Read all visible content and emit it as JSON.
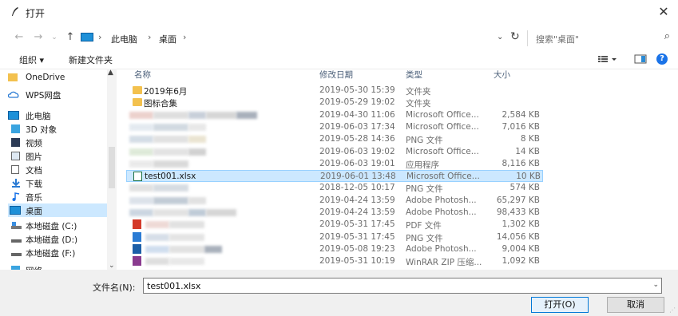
{
  "window": {
    "title": "打开",
    "close_glyph": "✕"
  },
  "address": {
    "breadcrumbs": [
      "此电脑",
      "桌面"
    ],
    "separator": "›",
    "search_placeholder": "搜索\"桌面\""
  },
  "toolbar": {
    "organize": "组织 ▾",
    "new_folder": "新建文件夹"
  },
  "sidebar": {
    "items": [
      {
        "label": "OneDrive",
        "icon": "folder-icon"
      },
      {
        "label": "WPS网盘",
        "icon": "cloud-icon"
      },
      {
        "label": "此电脑",
        "icon": "computer-icon"
      },
      {
        "label": "3D 对象",
        "icon": "cube-icon"
      },
      {
        "label": "视频",
        "icon": "video-icon"
      },
      {
        "label": "图片",
        "icon": "picture-icon"
      },
      {
        "label": "文档",
        "icon": "document-icon"
      },
      {
        "label": "下载",
        "icon": "download-icon"
      },
      {
        "label": "音乐",
        "icon": "music-icon"
      },
      {
        "label": "桌面",
        "icon": "desktop-icon",
        "selected": true
      },
      {
        "label": "本地磁盘 (C:)",
        "icon": "drive-c-icon"
      },
      {
        "label": "本地磁盘 (D:)",
        "icon": "drive-icon"
      },
      {
        "label": "本地磁盘 (F:)",
        "icon": "drive-icon"
      },
      {
        "label": "网络",
        "icon": "network-icon"
      }
    ]
  },
  "columns": {
    "name": "名称",
    "date": "修改日期",
    "type": "类型",
    "size": "大小"
  },
  "files": [
    {
      "name": "2019年6月",
      "date": "2019-05-30 15:39",
      "type": "文件夹",
      "size": "",
      "kind": "folder"
    },
    {
      "name": "图标合集",
      "date": "2019-05-29 19:02",
      "type": "文件夹",
      "size": "",
      "kind": "folder"
    },
    {
      "name": "",
      "date": "2019-04-30 11:06",
      "type": "Microsoft Office...",
      "size": "2,584 KB",
      "kind": "blur"
    },
    {
      "name": "",
      "date": "2019-06-03 17:34",
      "type": "Microsoft Office...",
      "size": "7,016 KB",
      "kind": "blur"
    },
    {
      "name": "",
      "date": "2019-05-28 14:36",
      "type": "PNG 文件",
      "size": "8 KB",
      "kind": "blur"
    },
    {
      "name": "",
      "date": "2019-06-03 19:02",
      "type": "Microsoft Office...",
      "size": "14 KB",
      "kind": "blur"
    },
    {
      "name": "",
      "date": "2019-06-03 19:01",
      "type": "应用程序",
      "size": "8,116 KB",
      "kind": "blur"
    },
    {
      "name": "test001.xlsx",
      "date": "2019-06-01 13:48",
      "type": "Microsoft Office...",
      "size": "10 KB",
      "kind": "excel",
      "selected": true
    },
    {
      "name": "",
      "date": "2018-12-05 10:17",
      "type": "PNG 文件",
      "size": "574 KB",
      "kind": "blur"
    },
    {
      "name": "",
      "date": "2019-04-24 13:59",
      "type": "Adobe Photosh...",
      "size": "65,297 KB",
      "kind": "blur"
    },
    {
      "name": "",
      "date": "2019-04-24 13:59",
      "type": "Adobe Photosh...",
      "size": "98,433 KB",
      "kind": "blur"
    },
    {
      "name": "",
      "date": "2019-05-31 17:45",
      "type": "PDF 文件",
      "size": "1,302 KB",
      "kind": "pdf"
    },
    {
      "name": "",
      "date": "2019-05-31 17:45",
      "type": "PNG 文件",
      "size": "14,056 KB",
      "kind": "png"
    },
    {
      "name": "",
      "date": "2019-05-08 19:23",
      "type": "Adobe Photosh...",
      "size": "9,004 KB",
      "kind": "psd"
    },
    {
      "name": "",
      "date": "2019-05-31 10:19",
      "type": "WinRAR ZIP 压缩...",
      "size": "1,092 KB",
      "kind": "zip"
    }
  ],
  "footer": {
    "filename_label": "文件名(N):",
    "filename_value": "test001.xlsx",
    "open_button": "打开(O)",
    "cancel_button": "取消"
  },
  "colors": {
    "accent": "#0078d7",
    "selection": "#cce8ff",
    "folder": "#f3c14e"
  }
}
